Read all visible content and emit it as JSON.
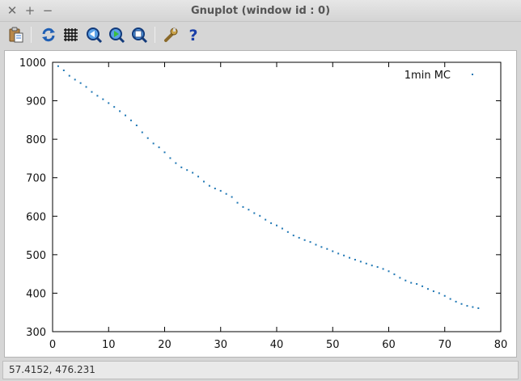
{
  "window": {
    "title": "Gnuplot (window id : 0)",
    "close_glyph": "✕",
    "maximize_glyph": "+",
    "minimize_glyph": "−"
  },
  "toolbar": {
    "items": [
      {
        "name": "copy-to-clipboard-button",
        "icon": "clipboard-icon"
      },
      {
        "name": "replot-button",
        "icon": "refresh-icon"
      },
      {
        "name": "toggle-grid-button",
        "icon": "grid-icon"
      },
      {
        "name": "previous-zoom-button",
        "icon": "zoom-previous-icon"
      },
      {
        "name": "next-zoom-button",
        "icon": "zoom-next-icon"
      },
      {
        "name": "autoscale-button",
        "icon": "zoom-autoscale-icon"
      },
      {
        "name": "configure-button",
        "icon": "wrench-icon"
      },
      {
        "name": "help-button",
        "icon": "help-icon"
      }
    ]
  },
  "colors": {
    "series": "#1f77b4",
    "axis": "#000000",
    "background": "#ffffff"
  },
  "status": {
    "coordinates": "57.4152,  476.231"
  },
  "chart_data": {
    "type": "scatter",
    "xlim": [
      0,
      80
    ],
    "ylim": [
      300,
      1000
    ],
    "xticks": [
      0,
      10,
      20,
      30,
      40,
      50,
      60,
      70,
      80
    ],
    "yticks": [
      300,
      400,
      500,
      600,
      700,
      800,
      900,
      1000
    ],
    "xlabel": "",
    "ylabel": "",
    "grid": false,
    "legend_position": "top-right",
    "series": [
      {
        "name": "1min MC",
        "x": [
          1,
          2,
          3,
          4,
          5,
          6,
          7,
          8,
          9,
          10,
          11,
          12,
          13,
          14,
          15,
          16,
          17,
          18,
          19,
          20,
          21,
          22,
          23,
          24,
          25,
          26,
          27,
          28,
          29,
          30,
          31,
          32,
          33,
          34,
          35,
          36,
          37,
          38,
          39,
          40,
          41,
          42,
          43,
          44,
          45,
          46,
          47,
          48,
          49,
          50,
          51,
          52,
          53,
          54,
          55,
          56,
          57,
          58,
          59,
          60,
          61,
          62,
          63,
          64,
          65,
          66,
          67,
          68,
          69,
          70,
          71,
          72,
          73,
          74,
          75,
          76
        ],
        "y": [
          990,
          979,
          965,
          955,
          946,
          936,
          923,
          913,
          904,
          894,
          884,
          873,
          862,
          849,
          836,
          818,
          803,
          789,
          779,
          766,
          751,
          738,
          727,
          720,
          713,
          703,
          690,
          679,
          672,
          666,
          658,
          650,
          635,
          624,
          617,
          608,
          601,
          591,
          582,
          576,
          568,
          559,
          550,
          544,
          538,
          533,
          526,
          520,
          515,
          509,
          503,
          498,
          492,
          487,
          482,
          477,
          472,
          468,
          463,
          457,
          449,
          440,
          433,
          427,
          424,
          418,
          411,
          405,
          400,
          393,
          385,
          378,
          372,
          367,
          364,
          361
        ]
      }
    ]
  }
}
